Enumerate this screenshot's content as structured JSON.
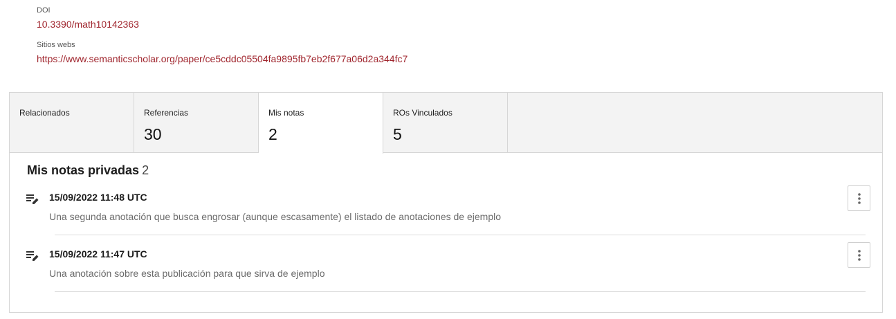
{
  "doi": {
    "label": "DOI",
    "value": "10.3390/math10142363"
  },
  "websites": {
    "label": "Sitios webs",
    "url": "https://www.semanticscholar.org/paper/ce5cddc05504fa9895fb7eb2f677a06d2a344fc7"
  },
  "tabs": [
    {
      "label": "Relacionados",
      "count": ""
    },
    {
      "label": "Referencias",
      "count": "30"
    },
    {
      "label": "Mis notas",
      "count": "2",
      "active": true
    },
    {
      "label": "ROs Vinculados",
      "count": "5"
    }
  ],
  "notes_section": {
    "title": "Mis notas privadas",
    "count": "2"
  },
  "notes": [
    {
      "date": "15/09/2022 11:48 UTC",
      "text": "Una segunda anotación que busca engrosar (aunque escasamente) el listado de anotaciones de ejemplo",
      "icon": "note-edit-icon"
    },
    {
      "date": "15/09/2022 11:47 UTC",
      "text": "Una anotación sobre esta publicación para que sirva de ejemplo",
      "icon": "note-edit-icon"
    }
  ],
  "colors": {
    "link": "#a0262e",
    "tabbar": "#f3f3f3"
  }
}
